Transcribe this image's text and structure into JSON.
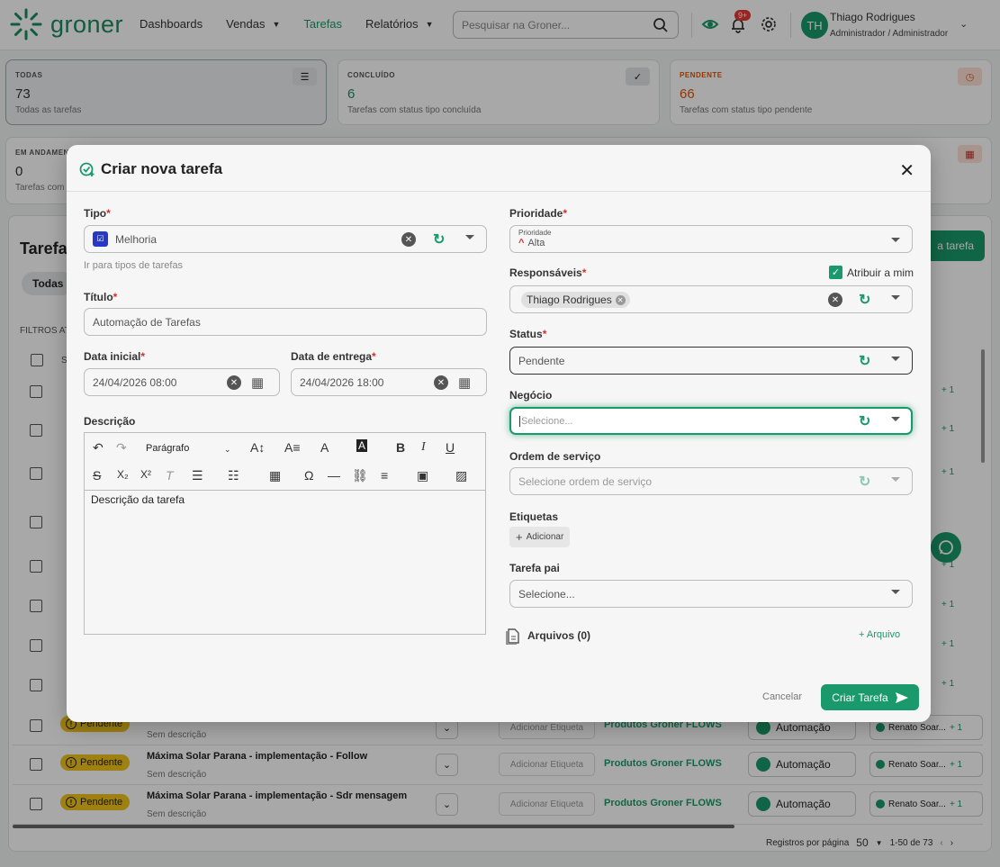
{
  "brand": {
    "name": "groner",
    "accent": "#1a9a6c"
  },
  "nav": {
    "items": [
      {
        "label": "Dashboards",
        "caret": false,
        "active": false
      },
      {
        "label": "Vendas",
        "caret": true,
        "active": false
      },
      {
        "label": "Tarefas",
        "caret": false,
        "active": true
      },
      {
        "label": "Relatórios",
        "caret": true,
        "active": false
      }
    ],
    "search_placeholder": "Pesquisar na Groner...",
    "notification_badge": "9+",
    "user_initials": "TH",
    "user_name": "Thiago Rodrigues",
    "user_role": "Administrador / Administrador"
  },
  "stats": [
    {
      "label": "TODAS",
      "value": "73",
      "sub": "Todas as tarefas",
      "icon": "list-icon",
      "color": "#333"
    },
    {
      "label": "CONCLUÍDO",
      "value": "6",
      "sub": "Tarefas com status tipo concluída",
      "icon": "check-circle-icon",
      "color": "#1a8a63"
    },
    {
      "label": "PENDENTE",
      "value": "66",
      "sub": "Tarefas com status tipo pendente",
      "icon": "clock-icon",
      "color": "#e65100"
    },
    {
      "label": "EM ANDAMEN",
      "value": "0",
      "sub": "Tarefas com",
      "icon": "calendar-icon",
      "color": "#333"
    }
  ],
  "tasks_panel": {
    "title": "Tarefa",
    "filter_tab": "Todas",
    "filters_label": "FILTROS AT",
    "new_task_button": "a tarefa",
    "column_partial": "S",
    "rows": [
      {
        "status": "Pendente",
        "title": "Máxima Solar Parana - implementação - Follow",
        "desc": "Sem descrição",
        "tag_placeholder": "Adicionar Etiqueta",
        "project": "Produtos Groner FLOWS",
        "type": "Automação",
        "assignee": "Renato Soar...",
        "extra": "+ 1"
      },
      {
        "status": "Pendente",
        "title": "Máxima Solar Parana - implementação - Sdr mensagem",
        "desc": "Sem descrição",
        "tag_placeholder": "Adicionar Etiqueta",
        "project": "Produtos Groner FLOWS",
        "type": "Automação",
        "assignee": "Renato Soar...",
        "extra": "+ 1"
      }
    ],
    "partial_row": {
      "status": "Pendente",
      "desc": "Sem descrição",
      "tag_placeholder": "Adicionar Etiqueta",
      "project": "Produtos Groner FLOWS",
      "type": "Automação",
      "assignee": "Renato Soar...",
      "extra": "+ 1"
    },
    "extra_count": "+ 1",
    "pagination": {
      "label": "Registros por página",
      "per_page": "50",
      "range": "1-50 de 73"
    }
  },
  "modal": {
    "title": "Criar nova tarefa",
    "tipo_label": "Tipo",
    "tipo_value": "Melhoria",
    "tipo_hint": "Ir para tipos de tarefas",
    "titulo_label": "Título",
    "titulo_value": "Automação de Tarefas",
    "data_inicial_label": "Data inicial",
    "data_inicial_value": "24/04/2026 08:00",
    "data_entrega_label": "Data de entrega",
    "data_entrega_value": "24/04/2026 18:00",
    "descricao_label": "Descrição",
    "paragraph_select": "Parágrafo",
    "descricao_value": "Descrição da tarefa",
    "prioridade_label": "Prioridade",
    "prioridade_float": "Prioridade",
    "prioridade_value": "Alta",
    "responsaveis_label": "Responsáveis",
    "atribuir_label": "Atribuir a mim",
    "responsavel_chip": "Thiago Rodrigues",
    "status_label": "Status",
    "status_value": "Pendente",
    "negocio_label": "Negócio",
    "negocio_placeholder": "Selecione...",
    "ordem_label": "Ordem de serviço",
    "ordem_placeholder": "Selecione ordem de serviço",
    "etiquetas_label": "Etiquetas",
    "add_tag": "Adicionar",
    "tarefa_pai_label": "Tarefa pai",
    "tarefa_pai_placeholder": "Selecione...",
    "arquivos_label": "Arquivos (0)",
    "add_file": "+ Arquivo",
    "cancel": "Cancelar",
    "submit": "Criar Tarefa"
  }
}
